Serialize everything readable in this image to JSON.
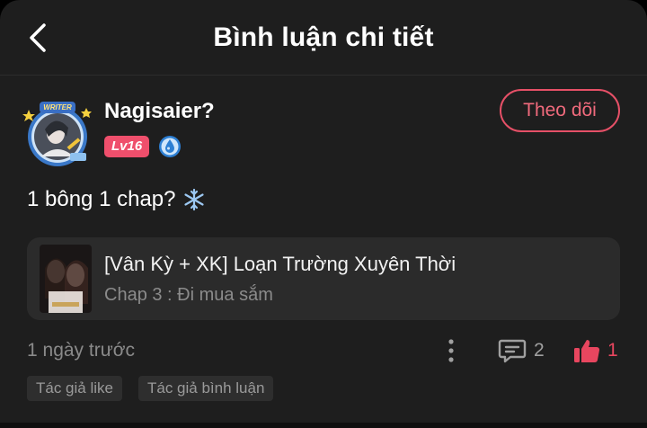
{
  "header": {
    "title": "Bình luận chi tiết"
  },
  "author": {
    "name": "Nagisaier?",
    "level": "Lv16",
    "avatar_badge_text": "WRITER",
    "follow_label": "Theo dõi"
  },
  "comment": {
    "text": "1 bông 1 chap?"
  },
  "story": {
    "title": "[Vân Kỳ + XK] Loạn Trường Xuyên Thời",
    "chapter": "Chap 3 : Đi mua sắm"
  },
  "meta": {
    "time": "1 ngày trước",
    "comments": "2",
    "likes": "1"
  },
  "tags": [
    "Tác giả like",
    "Tác giả bình luận"
  ],
  "colors": {
    "accent": "#e65067",
    "background": "#1e1e1e",
    "card": "#2b2b2b"
  }
}
